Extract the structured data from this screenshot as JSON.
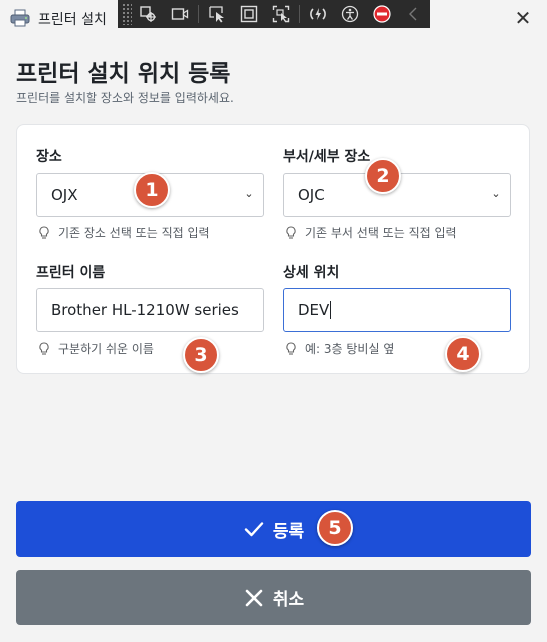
{
  "window": {
    "title": "프린터 설치",
    "close_icon": "close-icon",
    "app_icon": "printer-icon"
  },
  "devtools": {
    "icons": [
      "select-element-icon",
      "video-icon",
      "pointer-select-icon",
      "frame-icon",
      "track-focus-icon",
      "hot-reload-icon",
      "accessibility-icon",
      "stop-icon",
      "collapse-icon"
    ]
  },
  "page": {
    "title": "프린터 설치 위치 등록",
    "subtitle": "프린터를 설치할 장소와 정보를 입력하세요."
  },
  "form": {
    "location": {
      "label": "장소",
      "value": "OJX",
      "hint": "기존 장소 선택 또는 직접 입력"
    },
    "department": {
      "label": "부서/세부 장소",
      "value": "OJC",
      "hint": "기존 부서 선택 또는 직접 입력"
    },
    "printer_name": {
      "label": "프린터 이름",
      "value": "Brother HL-1210W series",
      "hint": "구분하기 쉬운 이름"
    },
    "detail_location": {
      "label": "상세 위치",
      "value": "DEV",
      "hint": "예: 3층 탕비실 옆"
    }
  },
  "actions": {
    "register_label": "등록",
    "cancel_label": "취소"
  },
  "markers": [
    "1",
    "2",
    "3",
    "4",
    "5"
  ],
  "colors": {
    "primary": "#1d4fd8",
    "secondary": "#6c757d",
    "marker": "#d8553a",
    "focus_border": "#3b6fd6"
  }
}
